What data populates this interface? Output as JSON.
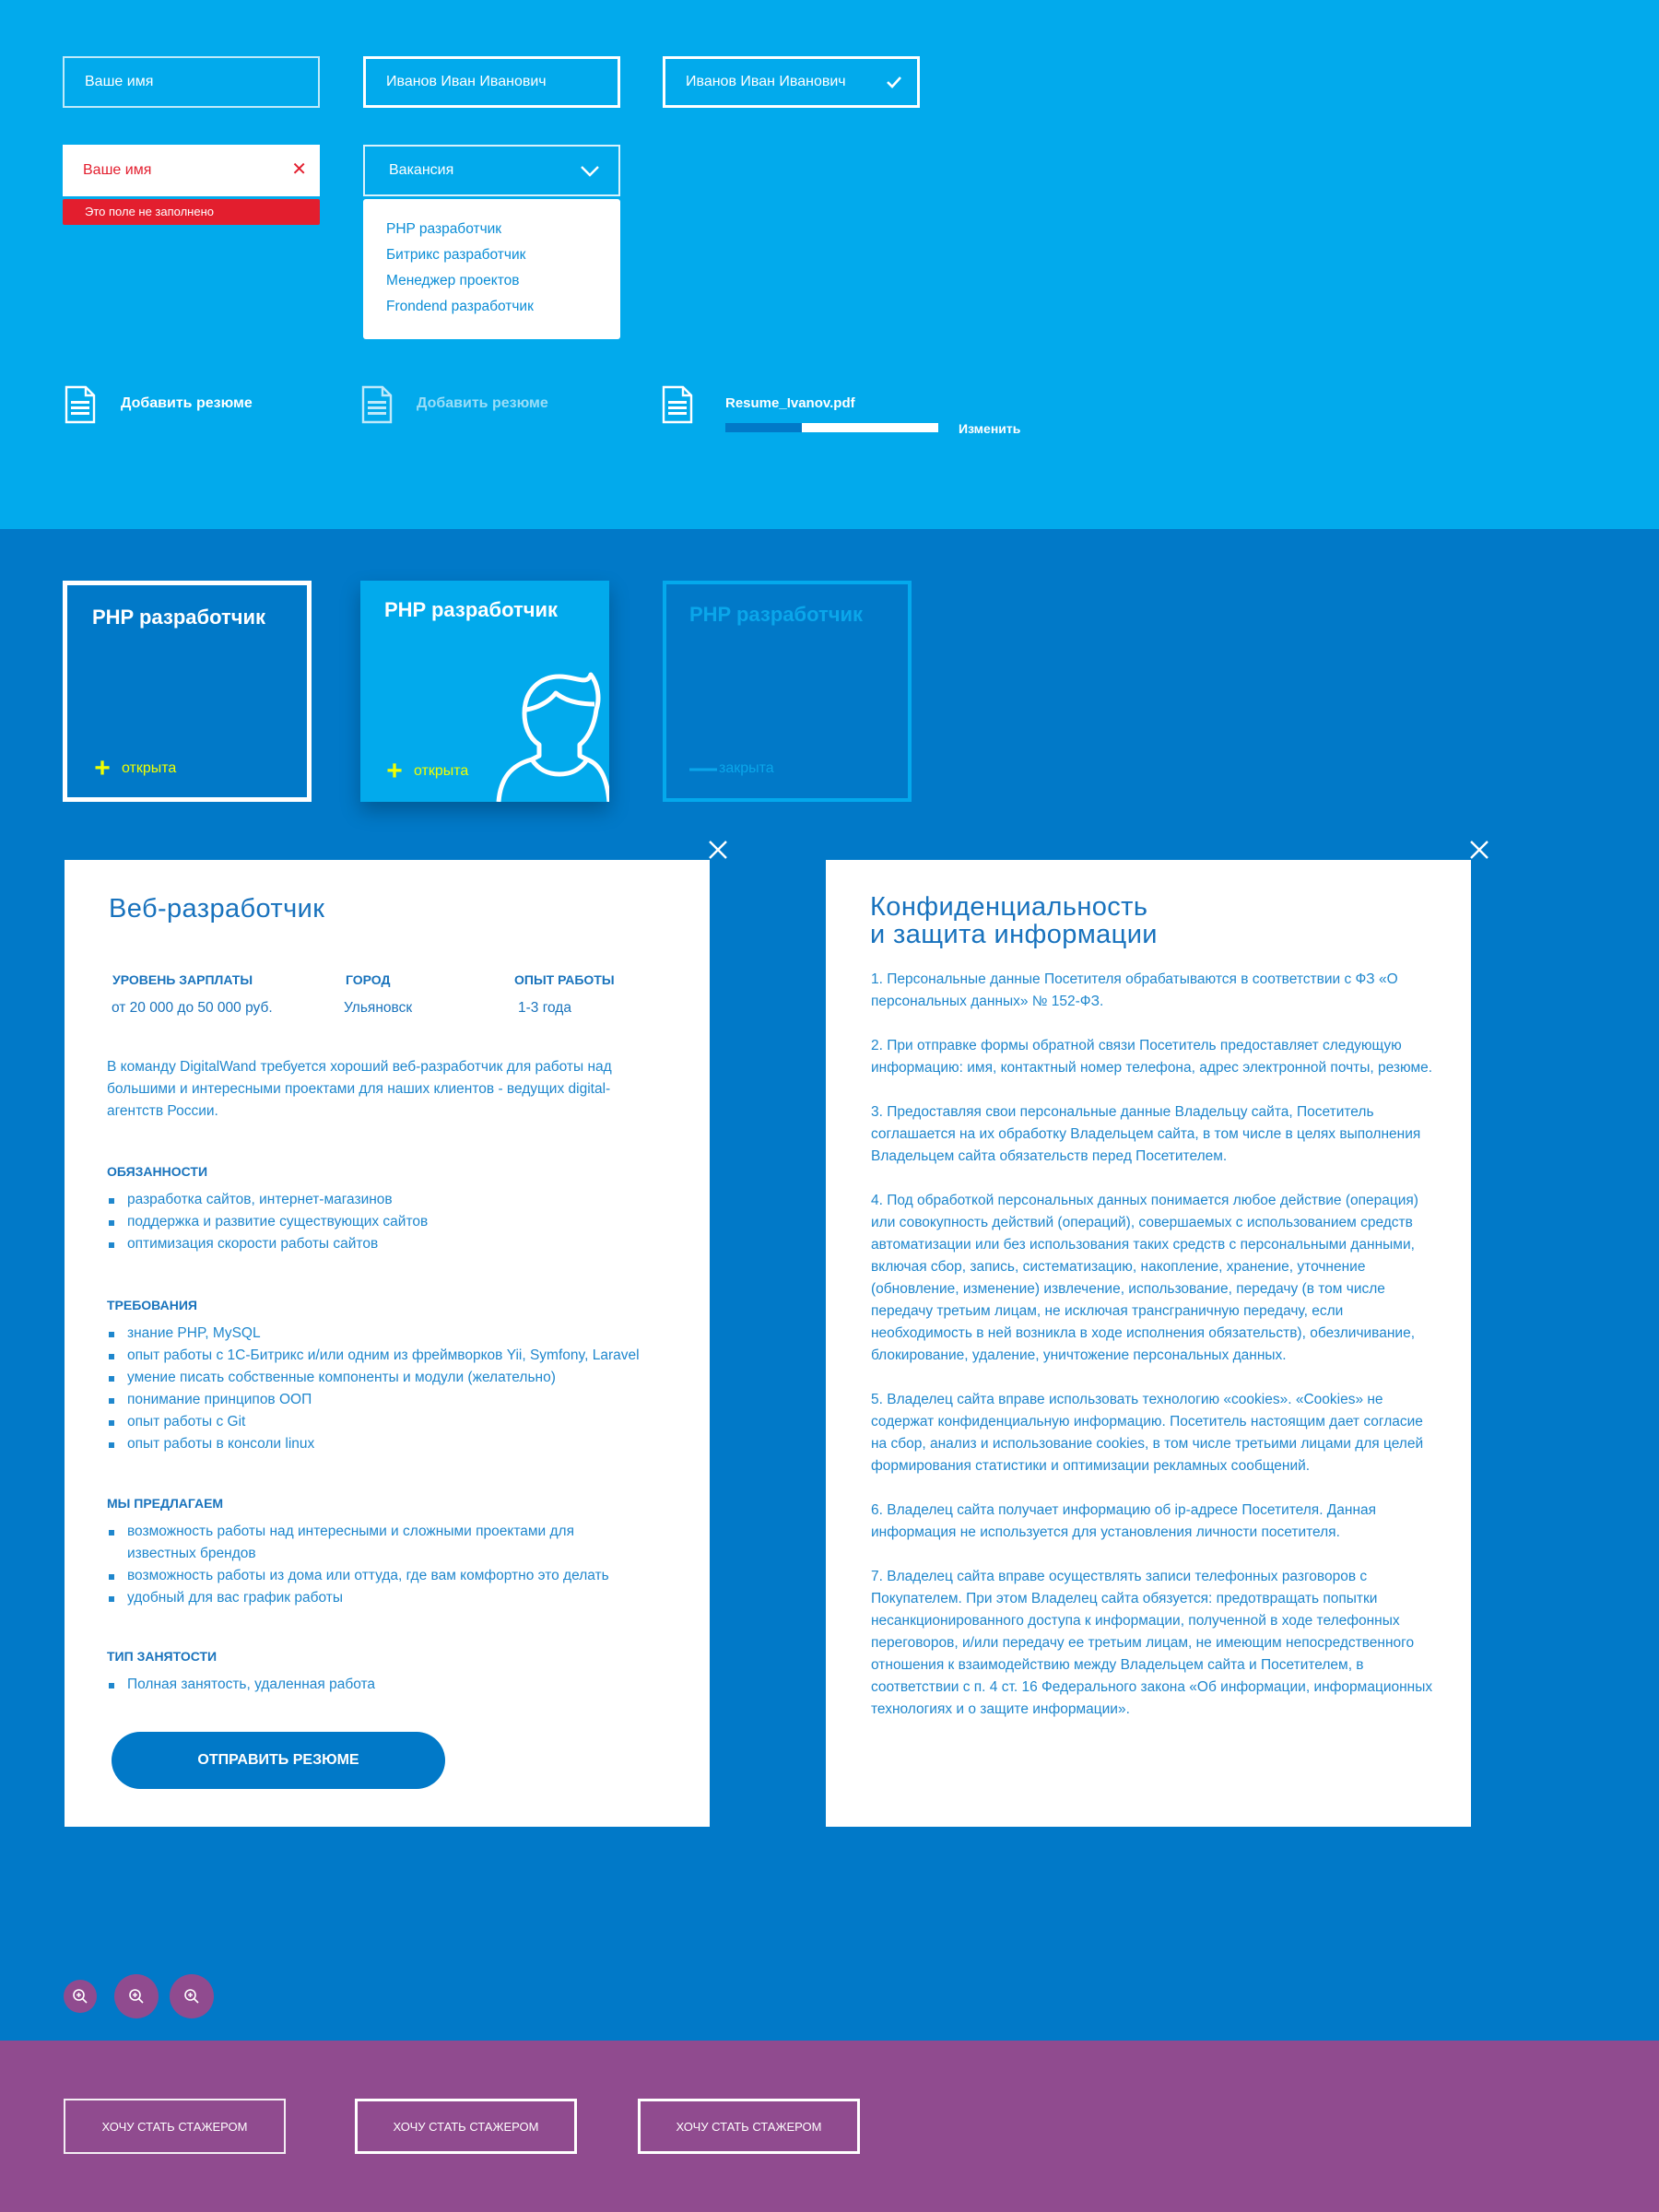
{
  "form": {
    "name_placeholder": "Ваше имя",
    "name_value": "Иванов Иван Иванович",
    "name_valid_value": "Иванов Иван Иванович",
    "name_error_placeholder": "Ваше имя",
    "error_message": "Это поле не заполнено",
    "vacancy_select": "Вакансия",
    "vacancy_options": [
      "PHP разработчик",
      "Битрикс разработчик",
      "Менеджер проектов",
      "Frondend разработчик"
    ]
  },
  "upload": {
    "add_label": "Добавить резюме",
    "add_label_hover": "Добавить резюме",
    "file_name": "Resume_Ivanov.pdf",
    "progress": 0.36,
    "change_label": "Изменить"
  },
  "vacancy_cards": [
    {
      "title": "PHP разработчик",
      "status": "открыта",
      "symbol": "+"
    },
    {
      "title": "PHP разработчик",
      "status": "открыта",
      "symbol": "+"
    },
    {
      "title": "PHP разработчик",
      "status": "закрыта",
      "symbol": "—"
    }
  ],
  "job": {
    "title": "Веб-разработчик",
    "salary_label": "УРОВЕНЬ ЗАРПЛАТЫ",
    "salary_value": "от 20 000 до 50 000 руб.",
    "city_label": "ГОРОД",
    "city_value": "Ульяновск",
    "exp_label": "ОПЫТ РАБОТЫ",
    "exp_value": "1-3 года",
    "intro": "В команду DigitalWand требуется хороший веб-разработчик для работы над большими и интересными проектами для наших клиентов - ведущих digital-агентств России.",
    "duties_title": "ОБЯЗАННОСТИ",
    "duties": [
      "разработка сайтов, интернет-магазинов",
      "поддержка и развитие существующих сайтов",
      "оптимизация скорости работы сайтов"
    ],
    "req_title": "ТРЕБОВАНИЯ",
    "requirements": [
      "знание PHP, MySQL",
      "опыт работы с 1С-Битрикс и/или одним из фреймворков Yii, Symfony, Laravel",
      "умение писать собственные компоненты и модули (желательно)",
      "понимание принципов ООП",
      "опыт работы с Git",
      "опыт работы в консоли linux"
    ],
    "offer_title": "МЫ ПРЕДЛАГАЕМ",
    "offers": [
      "возможность работы над интересными и сложными проектами для известных брендов",
      "возможность работы из дома или оттуда, где вам комфортно это делать",
      "удобный для вас график работы"
    ],
    "type_title": "ТИП ЗАНЯТОСТИ",
    "types": [
      "Полная занятость, удаленная работа"
    ],
    "send_button": "ОТПРАВИТЬ РЕЗЮМЕ"
  },
  "privacy": {
    "title_line1": "Конфиденциальность",
    "title_line2": "и защита информации",
    "paragraphs": [
      "1. Персональные данные Посетителя обрабатываются в соответствии с ФЗ «О персональных данных» № 152-ФЗ.",
      "2. При отправке формы обратной связи Посетитель предоставляет следующую информацию: имя, контактный номер телефона, адрес электронной почты, резюме.",
      "3. Предоставляя свои персональные данные Владельцу сайта, Посетитель соглашается на их обработку Владельцем сайта, в том числе в целях выполнения Владельцем сайта обязательств перед Посетителем.",
      "4. Под обработкой персональных данных понимается любое действие (операция) или совокупность действий (операций), совершаемых с использованием средств автоматизации или без использования таких средств с персональными данными, включая сбор, запись, систематизацию, накопление, хранение, уточнение (обновление, изменение) извлечение, использование, передачу (в том числе передачу третьим лицам, не исключая трансграничную передачу, если необходимость в ней возникла в ходе исполнения обязательств), обезличивание, блокирование, удаление, уничтожение персональных данных.",
      "5. Владелец сайта вправе использовать технологию «cookies». «Cookies» не содержат конфиденциальную информацию. Посетитель настоящим дает согласие на сбор, анализ и использование cookies, в том числе третьими лицами для целей формирования статистики и оптимизации рекламных сообщений.",
      "6. Владелец сайта получает информацию об ip-адресе Посетителя. Данная информация не используется для установления личности посетителя.",
      "7. Владелец сайта вправе осуществлять записи телефонных разговоров с Покупателем. При этом Владелец сайта обязуется: предотвращать попытки несанкционированного доступа к информации, полученной в ходе телефонных переговоров, и/или передачу ее третьим лицам, не имеющим непосредственного отношения к взаимодействию между Владельцем сайта и Посетителем, в соответствии с п. 4 ст. 16 Федерального закона «Об информации, информационных технологиях и о защите информации»."
    ]
  },
  "intern_buttons": [
    "ХОЧУ СТАТЬ СТАЖЕРОМ",
    "ХОЧУ СТАТЬ СТАЖЕРОМ",
    "ХОЧУ СТАТЬ СТАЖЕРОМ"
  ],
  "icons": {
    "check": "check-icon",
    "cross": "cross-icon",
    "chevron": "chevron-down-icon",
    "file": "document-icon",
    "close": "close-icon",
    "zoom": "zoom-in-icon",
    "avatar": "person-avatar-icon"
  },
  "colors": {
    "light_blue": "#02aaec",
    "dark_blue": "#0179c8",
    "purple": "#904b8f",
    "error_red": "#e31e2e",
    "status_yellow": "#f0ff00"
  }
}
